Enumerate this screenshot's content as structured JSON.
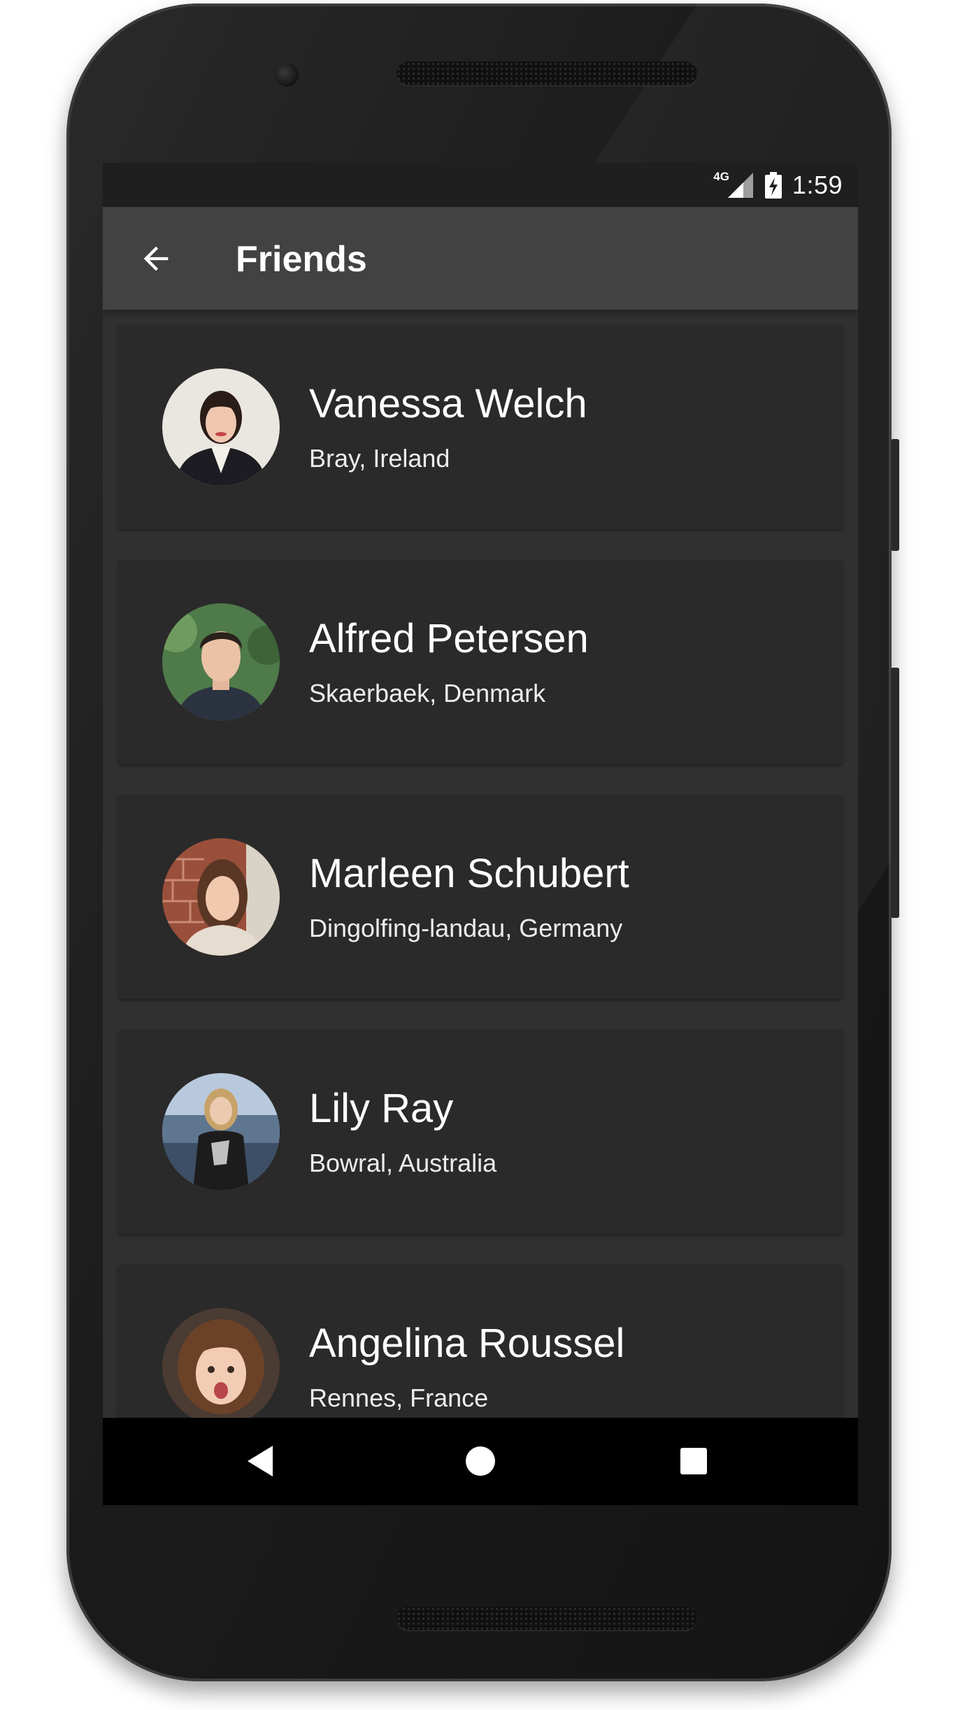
{
  "status_bar": {
    "network_label": "4G",
    "time": "1:59"
  },
  "app_bar": {
    "title": "Friends",
    "back_icon": "arrow-back-icon"
  },
  "friends": [
    {
      "name": "Vanessa Welch",
      "location": "Bray, Ireland"
    },
    {
      "name": "Alfred Petersen",
      "location": "Skaerbaek, Denmark"
    },
    {
      "name": "Marleen Schubert",
      "location": "Dingolfing-landau, Germany"
    },
    {
      "name": "Lily Ray",
      "location": "Bowral, Australia"
    },
    {
      "name": "Angelina Roussel",
      "location": "Rennes, France"
    }
  ],
  "nav_bar": {
    "back_icon": "triangle-back-icon",
    "home_icon": "circle-home-icon",
    "recents_icon": "square-recents-icon"
  },
  "colors": {
    "screen_background": "#303030",
    "app_bar": "#424242",
    "status_bar": "#1f1f1f",
    "card": "#2a2a2a",
    "nav_bar": "#000000",
    "text_primary": "#ffffff"
  }
}
